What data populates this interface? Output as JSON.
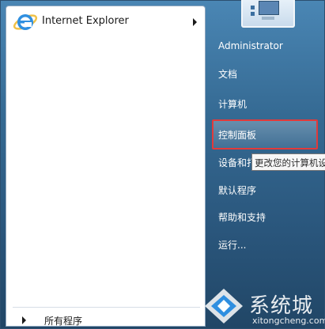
{
  "left_panel": {
    "pinned_item": {
      "label": "Internet Explorer",
      "icon": "internet-explorer-icon"
    },
    "all_programs": {
      "label": "所有程序"
    }
  },
  "right_panel": {
    "user_picture_icon": "user-picture-icon",
    "items": [
      {
        "label": "Administrator"
      },
      {
        "label": "文档"
      },
      {
        "label": "计算机"
      },
      {
        "label": "控制面板"
      },
      {
        "label": "设备和打"
      },
      {
        "label": "默认程序"
      },
      {
        "label": "帮助和支持"
      },
      {
        "label": "运行..."
      }
    ]
  },
  "tooltip": {
    "text": "更改您的计算机设"
  },
  "watermark": {
    "cn": "系统城",
    "url": "xitongcheng.com"
  },
  "colors": {
    "highlight_border": "#e23a3a",
    "menu_blue": "#356a93"
  }
}
